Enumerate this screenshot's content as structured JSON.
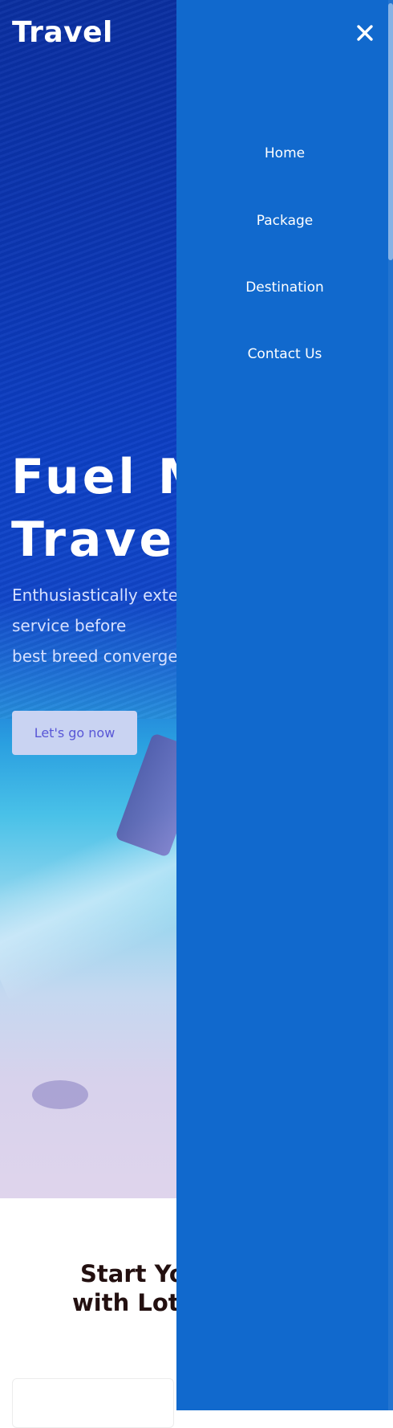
{
  "header": {
    "brand": "Travel"
  },
  "hero": {
    "title_lines": [
      "Fuel M",
      "Travel"
    ],
    "text_lines": [
      "Enthusiastically exter",
      "service before",
      "best breed converge"
    ],
    "cta_label": "Let's go now"
  },
  "section": {
    "title_lines": [
      "Start You",
      "with Lots"
    ]
  },
  "drawer": {
    "close_icon": "close-icon",
    "items": [
      {
        "label": "Home"
      },
      {
        "label": "Package"
      },
      {
        "label": "Destination"
      },
      {
        "label": "Contact Us"
      }
    ],
    "background": "#1169cd"
  },
  "colors": {
    "accent": "#1169cd",
    "cta_text": "#5856d6",
    "cta_bg": "#c9d3f2",
    "heading": "#231010"
  }
}
